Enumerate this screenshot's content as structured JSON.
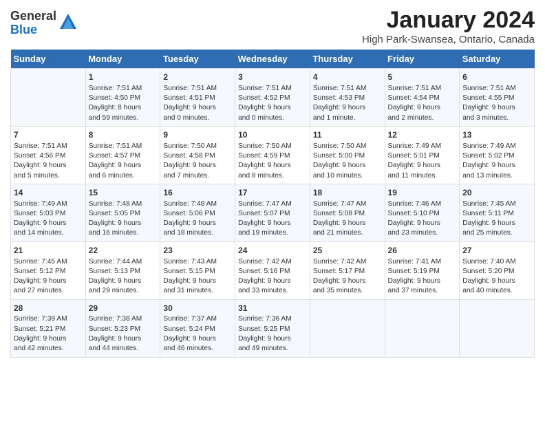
{
  "header": {
    "logo_line1": "General",
    "logo_line2": "Blue",
    "title": "January 2024",
    "subtitle": "High Park-Swansea, Ontario, Canada"
  },
  "days_of_week": [
    "Sunday",
    "Monday",
    "Tuesday",
    "Wednesday",
    "Thursday",
    "Friday",
    "Saturday"
  ],
  "weeks": [
    [
      {
        "day": "",
        "info": ""
      },
      {
        "day": "1",
        "info": "Sunrise: 7:51 AM\nSunset: 4:50 PM\nDaylight: 8 hours\nand 59 minutes."
      },
      {
        "day": "2",
        "info": "Sunrise: 7:51 AM\nSunset: 4:51 PM\nDaylight: 9 hours\nand 0 minutes."
      },
      {
        "day": "3",
        "info": "Sunrise: 7:51 AM\nSunset: 4:52 PM\nDaylight: 9 hours\nand 0 minutes."
      },
      {
        "day": "4",
        "info": "Sunrise: 7:51 AM\nSunset: 4:53 PM\nDaylight: 9 hours\nand 1 minute."
      },
      {
        "day": "5",
        "info": "Sunrise: 7:51 AM\nSunset: 4:54 PM\nDaylight: 9 hours\nand 2 minutes."
      },
      {
        "day": "6",
        "info": "Sunrise: 7:51 AM\nSunset: 4:55 PM\nDaylight: 9 hours\nand 3 minutes."
      }
    ],
    [
      {
        "day": "7",
        "info": "Sunrise: 7:51 AM\nSunset: 4:56 PM\nDaylight: 9 hours\nand 5 minutes."
      },
      {
        "day": "8",
        "info": "Sunrise: 7:51 AM\nSunset: 4:57 PM\nDaylight: 9 hours\nand 6 minutes."
      },
      {
        "day": "9",
        "info": "Sunrise: 7:50 AM\nSunset: 4:58 PM\nDaylight: 9 hours\nand 7 minutes."
      },
      {
        "day": "10",
        "info": "Sunrise: 7:50 AM\nSunset: 4:59 PM\nDaylight: 9 hours\nand 8 minutes."
      },
      {
        "day": "11",
        "info": "Sunrise: 7:50 AM\nSunset: 5:00 PM\nDaylight: 9 hours\nand 10 minutes."
      },
      {
        "day": "12",
        "info": "Sunrise: 7:49 AM\nSunset: 5:01 PM\nDaylight: 9 hours\nand 11 minutes."
      },
      {
        "day": "13",
        "info": "Sunrise: 7:49 AM\nSunset: 5:02 PM\nDaylight: 9 hours\nand 13 minutes."
      }
    ],
    [
      {
        "day": "14",
        "info": "Sunrise: 7:49 AM\nSunset: 5:03 PM\nDaylight: 9 hours\nand 14 minutes."
      },
      {
        "day": "15",
        "info": "Sunrise: 7:48 AM\nSunset: 5:05 PM\nDaylight: 9 hours\nand 16 minutes."
      },
      {
        "day": "16",
        "info": "Sunrise: 7:48 AM\nSunset: 5:06 PM\nDaylight: 9 hours\nand 18 minutes."
      },
      {
        "day": "17",
        "info": "Sunrise: 7:47 AM\nSunset: 5:07 PM\nDaylight: 9 hours\nand 19 minutes."
      },
      {
        "day": "18",
        "info": "Sunrise: 7:47 AM\nSunset: 5:08 PM\nDaylight: 9 hours\nand 21 minutes."
      },
      {
        "day": "19",
        "info": "Sunrise: 7:46 AM\nSunset: 5:10 PM\nDaylight: 9 hours\nand 23 minutes."
      },
      {
        "day": "20",
        "info": "Sunrise: 7:45 AM\nSunset: 5:11 PM\nDaylight: 9 hours\nand 25 minutes."
      }
    ],
    [
      {
        "day": "21",
        "info": "Sunrise: 7:45 AM\nSunset: 5:12 PM\nDaylight: 9 hours\nand 27 minutes."
      },
      {
        "day": "22",
        "info": "Sunrise: 7:44 AM\nSunset: 5:13 PM\nDaylight: 9 hours\nand 29 minutes."
      },
      {
        "day": "23",
        "info": "Sunrise: 7:43 AM\nSunset: 5:15 PM\nDaylight: 9 hours\nand 31 minutes."
      },
      {
        "day": "24",
        "info": "Sunrise: 7:42 AM\nSunset: 5:16 PM\nDaylight: 9 hours\nand 33 minutes."
      },
      {
        "day": "25",
        "info": "Sunrise: 7:42 AM\nSunset: 5:17 PM\nDaylight: 9 hours\nand 35 minutes."
      },
      {
        "day": "26",
        "info": "Sunrise: 7:41 AM\nSunset: 5:19 PM\nDaylight: 9 hours\nand 37 minutes."
      },
      {
        "day": "27",
        "info": "Sunrise: 7:40 AM\nSunset: 5:20 PM\nDaylight: 9 hours\nand 40 minutes."
      }
    ],
    [
      {
        "day": "28",
        "info": "Sunrise: 7:39 AM\nSunset: 5:21 PM\nDaylight: 9 hours\nand 42 minutes."
      },
      {
        "day": "29",
        "info": "Sunrise: 7:38 AM\nSunset: 5:23 PM\nDaylight: 9 hours\nand 44 minutes."
      },
      {
        "day": "30",
        "info": "Sunrise: 7:37 AM\nSunset: 5:24 PM\nDaylight: 9 hours\nand 46 minutes."
      },
      {
        "day": "31",
        "info": "Sunrise: 7:36 AM\nSunset: 5:25 PM\nDaylight: 9 hours\nand 49 minutes."
      },
      {
        "day": "",
        "info": ""
      },
      {
        "day": "",
        "info": ""
      },
      {
        "day": "",
        "info": ""
      }
    ]
  ]
}
